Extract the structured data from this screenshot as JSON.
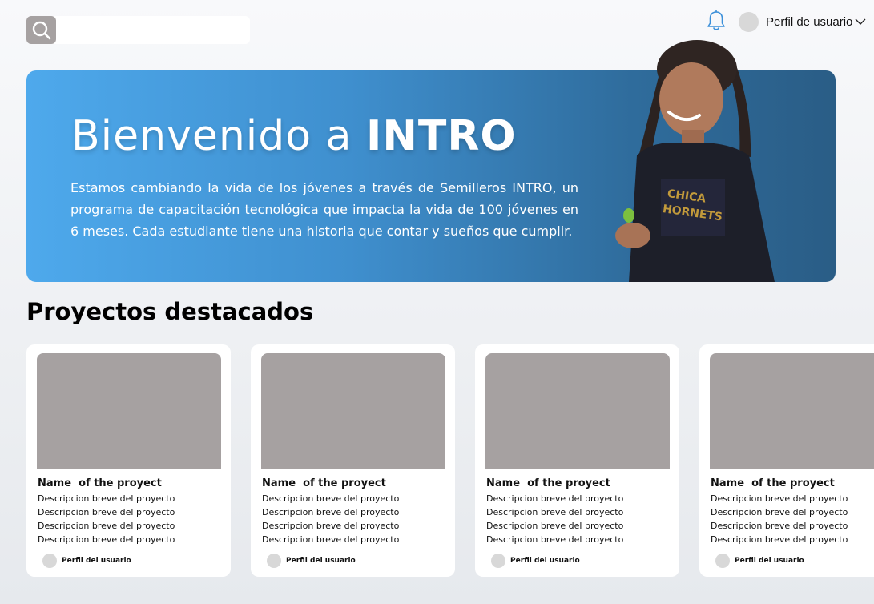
{
  "header": {
    "search": {
      "value": "",
      "placeholder": ""
    },
    "user_menu_label": "Perfil de usuario"
  },
  "hero": {
    "title_regular": "Bienvenido a ",
    "title_bold": "INTRO",
    "text": "Estamos cambiando la vida de los jóvenes a través de Semilleros INTRO, un programa de capacitación tecnológica que impacta la vida de 100 jóvenes en 6 meses. Cada estudiante tiene una historia que contar y sueños que cumplir."
  },
  "section": {
    "title": "Proyectos destacados"
  },
  "cards": [
    {
      "name": "Name  of the proyect",
      "descriptions": [
        "Descripcion breve del proyecto",
        "Descripcion breve del proyecto",
        "Descripcion breve del proyecto",
        "Descripcion breve del proyecto"
      ],
      "user_label": "Perfil del usuario"
    },
    {
      "name": "Name  of the proyect",
      "descriptions": [
        "Descripcion breve del proyecto",
        "Descripcion breve del proyecto",
        "Descripcion breve del proyecto",
        "Descripcion breve del proyecto"
      ],
      "user_label": "Perfil del usuario"
    },
    {
      "name": "Name  of the proyect",
      "descriptions": [
        "Descripcion breve del proyecto",
        "Descripcion breve del proyecto",
        "Descripcion breve del proyecto",
        "Descripcion breve del proyecto"
      ],
      "user_label": "Perfil del usuario"
    },
    {
      "name": "Name  of the proyect",
      "descriptions": [
        "Descripcion breve del proyecto",
        "Descripcion breve del proyecto",
        "Descripcion breve del proyecto",
        "Descripcion breve del proyecto"
      ],
      "user_label": "Perfil del usuario"
    }
  ],
  "icons": {
    "search": "search-icon",
    "notifications": "bell-icon",
    "dropdown": "chevron-down-icon"
  },
  "colors": {
    "hero_start": "#4ea9ec",
    "hero_end": "#2a5d86",
    "placeholder_gray": "#a6a1a1",
    "bell_blue": "#3b8fd9"
  }
}
